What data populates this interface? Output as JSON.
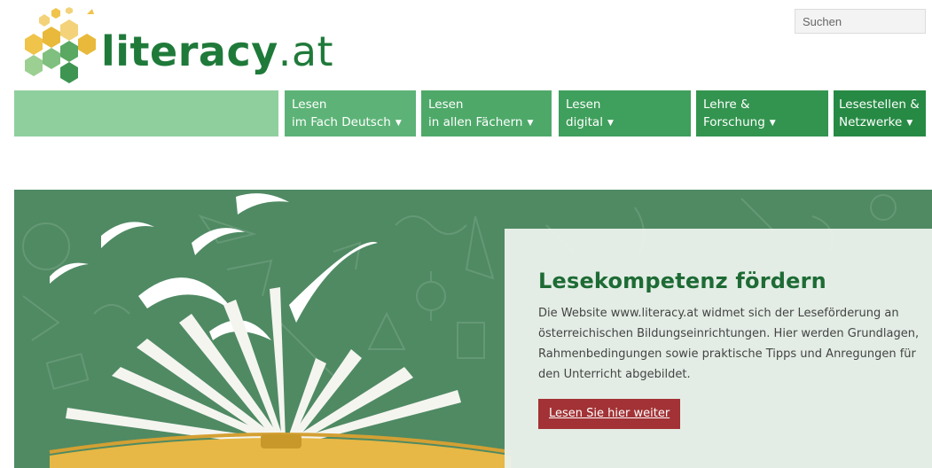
{
  "brand": {
    "name_bold": "literacy",
    "name_suffix": ".at",
    "colors": {
      "primary_green": "#1f7a3a",
      "gold": "#e8b93a",
      "accent_red": "#a23235"
    }
  },
  "search": {
    "placeholder": "Suchen"
  },
  "nav": {
    "items": [
      {
        "line1": "Lesen",
        "line2": "im Fach Deutsch",
        "color": "#5db377",
        "icon": "caret-down-icon"
      },
      {
        "line1": "Lesen",
        "line2": "in allen Fächern",
        "color": "#4ea969",
        "icon": "caret-down-icon"
      },
      {
        "line1": "Lesen",
        "line2": "digital",
        "color": "#3f9f5c",
        "icon": "caret-down-icon"
      },
      {
        "line1": "Lehre &",
        "line2": "Forschung",
        "color": "#33944f",
        "icon": "caret-down-icon"
      },
      {
        "line1": "Lesestellen &",
        "line2": "Netzwerke",
        "color": "#268a44",
        "icon": "caret-down-icon"
      }
    ]
  },
  "hero": {
    "title": "Lesekompetenz fördern",
    "text": "Die Website www.literacy.at widmet sich der Leseförderung an österreichischen Bildungseinrichtungen. Hier werden Grundlagen, Rahmenbedingungen sowie praktische Tipps und Anregungen für den Unterricht abgebildet.",
    "button_label": "Lesen Sie hier weiter",
    "image": "open-book-flying-pages-illustration"
  }
}
